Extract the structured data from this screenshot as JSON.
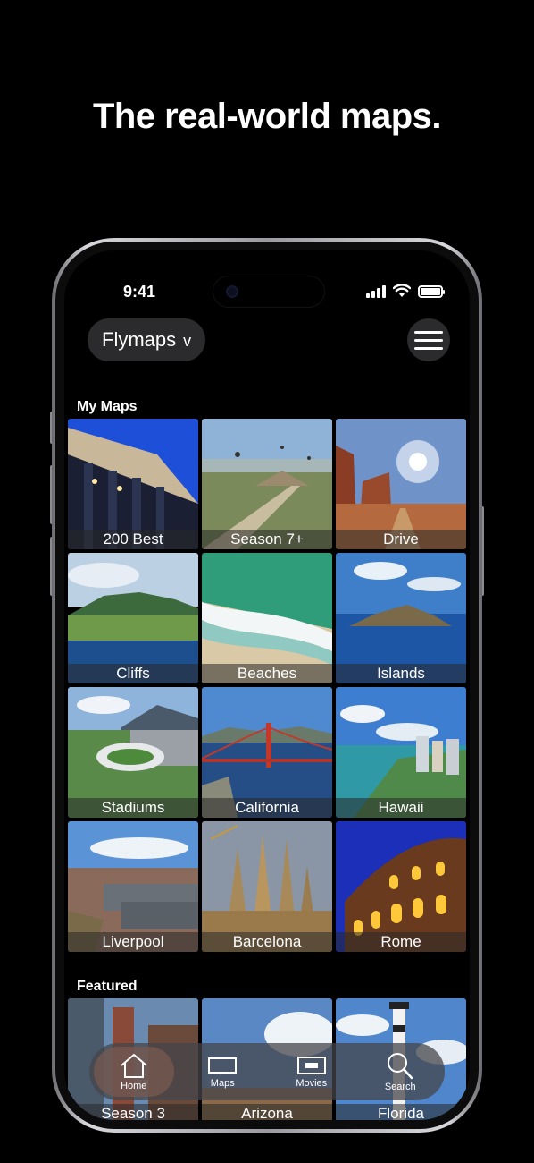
{
  "headline": "The real-world maps.",
  "status": {
    "time": "9:41"
  },
  "header": {
    "app_name": "Flymaps",
    "chevron": "v"
  },
  "sections": {
    "my_maps": "My Maps",
    "featured": "Featured"
  },
  "my_maps": [
    {
      "label": "200 Best",
      "icon": "image-temple"
    },
    {
      "label": "Season 7+",
      "icon": "image-pyramid"
    },
    {
      "label": "Drive",
      "icon": "image-desert-road"
    },
    {
      "label": "Cliffs",
      "icon": "image-cliffs"
    },
    {
      "label": "Beaches",
      "icon": "image-beach"
    },
    {
      "label": "Islands",
      "icon": "image-island"
    },
    {
      "label": "Stadiums",
      "icon": "image-stadium"
    },
    {
      "label": "California",
      "icon": "image-golden-gate"
    },
    {
      "label": "Hawaii",
      "icon": "image-hawaii"
    },
    {
      "label": "Liverpool",
      "icon": "image-liverpool"
    },
    {
      "label": "Barcelona",
      "icon": "image-sagrada-familia"
    },
    {
      "label": "Rome",
      "icon": "image-colosseum"
    }
  ],
  "featured": [
    {
      "label": "Season 3"
    },
    {
      "label": "Arizona"
    },
    {
      "label": "Florida"
    }
  ],
  "tabs": [
    {
      "label": "Home",
      "icon": "home-icon",
      "active": true
    },
    {
      "label": "Maps",
      "icon": "map-icon",
      "active": false
    },
    {
      "label": "Movies",
      "icon": "movie-icon",
      "active": false
    },
    {
      "label": "Search",
      "icon": "search-icon",
      "active": false
    }
  ]
}
